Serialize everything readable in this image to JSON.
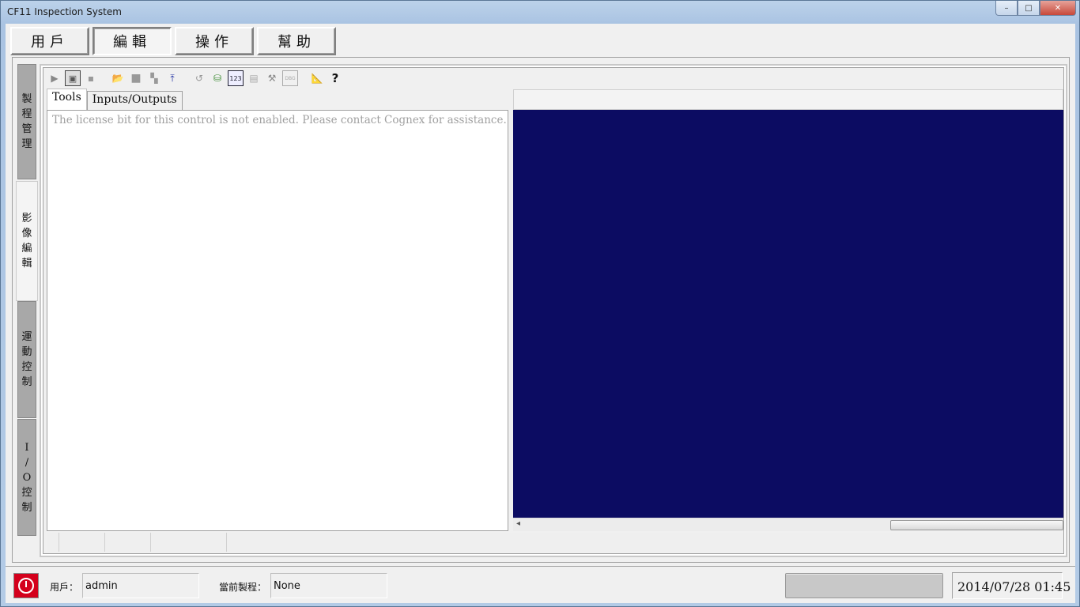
{
  "window": {
    "title": "CF11 Inspection System",
    "buttons": {
      "minimize": "–",
      "maximize": "□",
      "close": "✕"
    }
  },
  "menu": [
    {
      "label": "用戶"
    },
    {
      "label": "編輯",
      "active": true
    },
    {
      "label": "操作"
    },
    {
      "label": "幫助"
    }
  ],
  "side_tabs": [
    {
      "label": "製程管理"
    },
    {
      "label": "影像編輯",
      "active": true
    },
    {
      "label": "運動控制"
    },
    {
      "label": "I/O控制"
    }
  ],
  "toolbar": {
    "icons": [
      "run-icon",
      "display-icon",
      "record-icon",
      "open-folder-icon",
      "stop-icon",
      "link-icon",
      "import-icon",
      "undo-icon",
      "database-icon",
      "numeric-icon",
      "form-icon",
      "tools-icon",
      "debug-icon",
      "ruler-icon",
      "help-icon"
    ],
    "glyphs": [
      "▶",
      "▣",
      "▪",
      "📂",
      "■",
      "▚",
      "⤒",
      "↺",
      "⛁",
      "123",
      "▤",
      "⚒",
      "DBG",
      "📐",
      "?"
    ]
  },
  "tools_panel": {
    "tabs": [
      {
        "label": "Tools",
        "active": true
      },
      {
        "label": "Inputs/Outputs"
      }
    ],
    "message": "The license bit for this control is not enabled.  Please contact Cognex for assistance."
  },
  "display": {
    "background": "#0c0c62",
    "scroll_left_glyph": "◂"
  },
  "status": {
    "user_label": "用戶：",
    "user_value": "admin",
    "process_label": "當前製程：",
    "process_value": "None",
    "datetime": "2014/07/28 01:45",
    "power_color": "#d4001c"
  }
}
